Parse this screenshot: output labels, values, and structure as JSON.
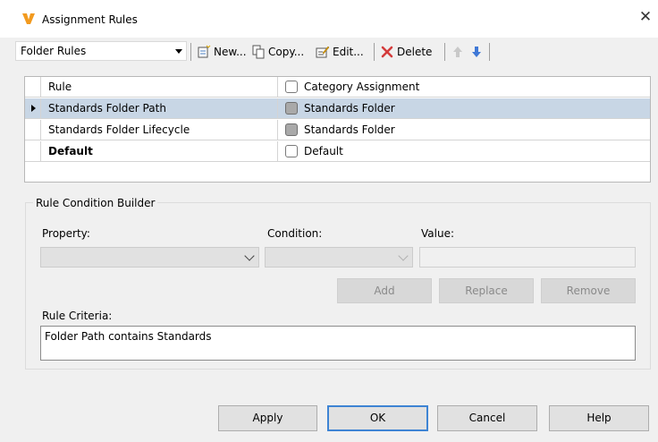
{
  "window": {
    "title": "Assignment Rules",
    "close_glyph": "✕"
  },
  "toolbar": {
    "folder_select_value": "Folder Rules",
    "new_label": "New...",
    "copy_label": "Copy...",
    "edit_label": "Edit...",
    "delete_label": "Delete"
  },
  "grid": {
    "headers": {
      "rule": "Rule",
      "category": "Category Assignment"
    },
    "rows": [
      {
        "rule": "Standards Folder Path",
        "category": "Standards Folder",
        "selected": true,
        "bold": false
      },
      {
        "rule": "Standards Folder Lifecycle",
        "category": "Standards Folder",
        "selected": false,
        "bold": false
      },
      {
        "rule": "Default",
        "category": "Default",
        "selected": false,
        "bold": true
      }
    ]
  },
  "builder": {
    "title": "Rule Condition Builder",
    "property_label": "Property:",
    "condition_label": "Condition:",
    "value_label": "Value:",
    "property_value": "",
    "condition_value": "",
    "value_value": "",
    "add_label": "Add",
    "replace_label": "Replace",
    "remove_label": "Remove",
    "criteria_label": "Rule Criteria:",
    "criteria_text": "Folder Path contains Standards"
  },
  "footer": {
    "apply_label": "Apply",
    "ok_label": "OK",
    "cancel_label": "Cancel",
    "help_label": "Help"
  },
  "colors": {
    "selected_row": "#c8d6e5",
    "default_button_border": "#3e84d4",
    "app_icon": "#f5a623"
  }
}
